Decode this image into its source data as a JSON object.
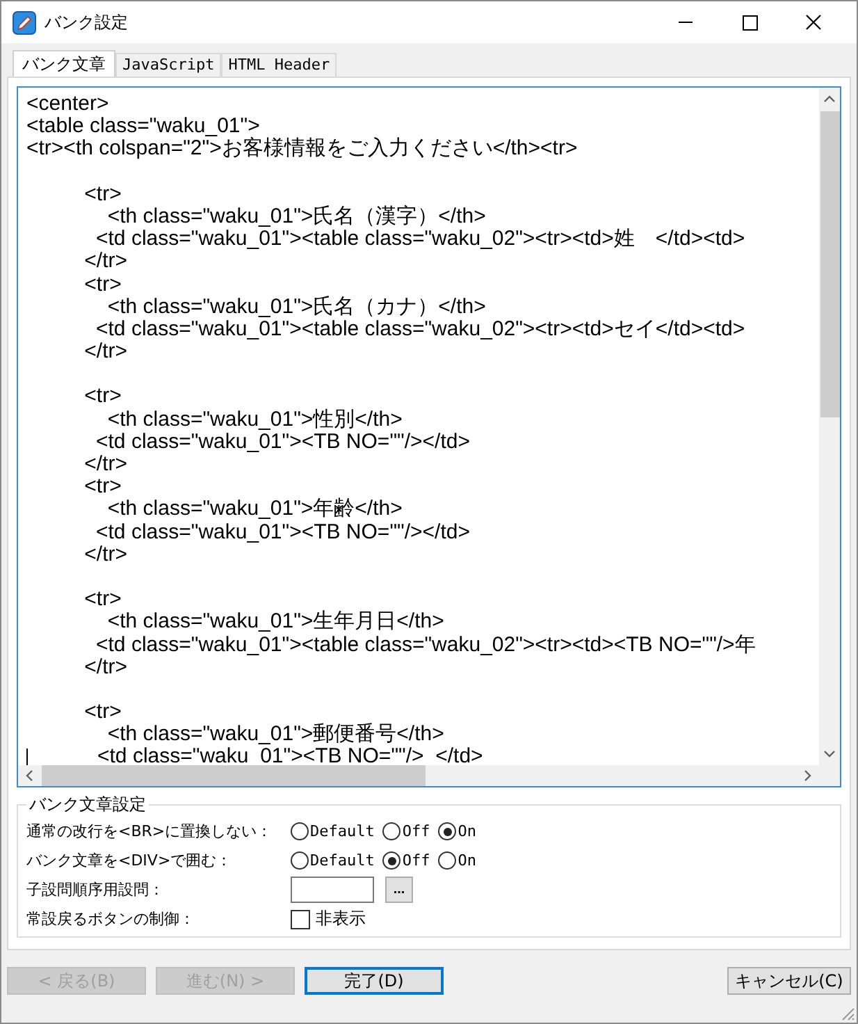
{
  "window": {
    "title": "バンク設定"
  },
  "tabs": [
    {
      "label": "バンク文章",
      "selected": true
    },
    {
      "label": "JavaScript",
      "selected": false
    },
    {
      "label": "HTML Header",
      "selected": false
    }
  ],
  "editor": {
    "blocks": [
      {
        "lines": [
          {
            "text": "<center>",
            "caret": false
          },
          {
            "text": "<table class=\"waku_01\">",
            "caret": false
          },
          {
            "text": "<tr><th colspan=\"2\">お客様情報をご入力ください</th><tr>",
            "caret": false
          }
        ]
      },
      {
        "lines": [
          {
            "text": "          <tr>",
            "caret": false
          },
          {
            "text": "              <th class=\"waku_01\">氏名（漢字）</th>",
            "caret": false
          },
          {
            "text": "            <td class=\"waku_01\"><table class=\"waku_02\"><tr><td>姓　</td><td>",
            "caret": false
          },
          {
            "text": "          </tr>",
            "caret": false
          },
          {
            "text": "          <tr>",
            "caret": false
          },
          {
            "text": "              <th class=\"waku_01\">氏名（カナ）</th>",
            "caret": false
          },
          {
            "text": "            <td class=\"waku_01\"><table class=\"waku_02\"><tr><td>セイ</td><td>",
            "caret": false
          },
          {
            "text": "          </tr>",
            "caret": false
          }
        ]
      },
      {
        "lines": [
          {
            "text": "          <tr>",
            "caret": false
          },
          {
            "text": "              <th class=\"waku_01\">性別</th>",
            "caret": false
          },
          {
            "text": "            <td class=\"waku_01\"><TB NO=\"\"/></td>",
            "caret": false
          },
          {
            "text": "          </tr>",
            "caret": false
          },
          {
            "text": "          <tr>",
            "caret": false
          },
          {
            "text": "              <th class=\"waku_01\">年齢</th>",
            "caret": false
          },
          {
            "text": "            <td class=\"waku_01\"><TB NO=\"\"/></td>",
            "caret": false
          },
          {
            "text": "          </tr>",
            "caret": false
          }
        ]
      },
      {
        "lines": [
          {
            "text": "          <tr>",
            "caret": false
          },
          {
            "text": "              <th class=\"waku_01\">生年月日</th>",
            "caret": false
          },
          {
            "text": "            <td class=\"waku_01\"><table class=\"waku_02\"><tr><td><TB NO=\"\"/>年",
            "caret": false
          },
          {
            "text": "          </tr>",
            "caret": false
          }
        ]
      },
      {
        "lines": [
          {
            "text": "          <tr>",
            "caret": false
          },
          {
            "text": "              <th class=\"waku_01\">郵便番号</th>",
            "caret": false
          },
          {
            "text": "            <td class=\"waku_01\"><TB NO=\"\"/>  </td>",
            "caret": true
          }
        ]
      }
    ]
  },
  "settings": {
    "title": "バンク文章設定",
    "rows": [
      {
        "kind": "radio",
        "label": "通常の改行を<BR>に置換しない：",
        "options": [
          {
            "label": "Default",
            "selected": false
          },
          {
            "label": "Off",
            "selected": false
          },
          {
            "label": "On",
            "selected": true
          }
        ]
      },
      {
        "kind": "radio",
        "label": "バンク文章を<DIV>で囲む：",
        "options": [
          {
            "label": "Default",
            "selected": false
          },
          {
            "label": "Off",
            "selected": true
          },
          {
            "label": "On",
            "selected": false
          }
        ]
      },
      {
        "kind": "text",
        "label": "子設問順序用設問：",
        "button": "..."
      },
      {
        "kind": "checkbox",
        "label": "常設戻るボタンの制御：",
        "option": "非表示",
        "checked": false
      }
    ]
  },
  "buttons": [
    {
      "label": "< 戻る(B)",
      "disabled": true,
      "focused": false,
      "kind": "nav"
    },
    {
      "label": "進む(N) >",
      "disabled": true,
      "focused": false,
      "kind": "nav"
    },
    {
      "label": "完了(D)",
      "disabled": false,
      "focused": true,
      "kind": "finish"
    },
    {
      "label": "キャンセル(C)",
      "disabled": false,
      "focused": false,
      "kind": "cancel"
    }
  ]
}
